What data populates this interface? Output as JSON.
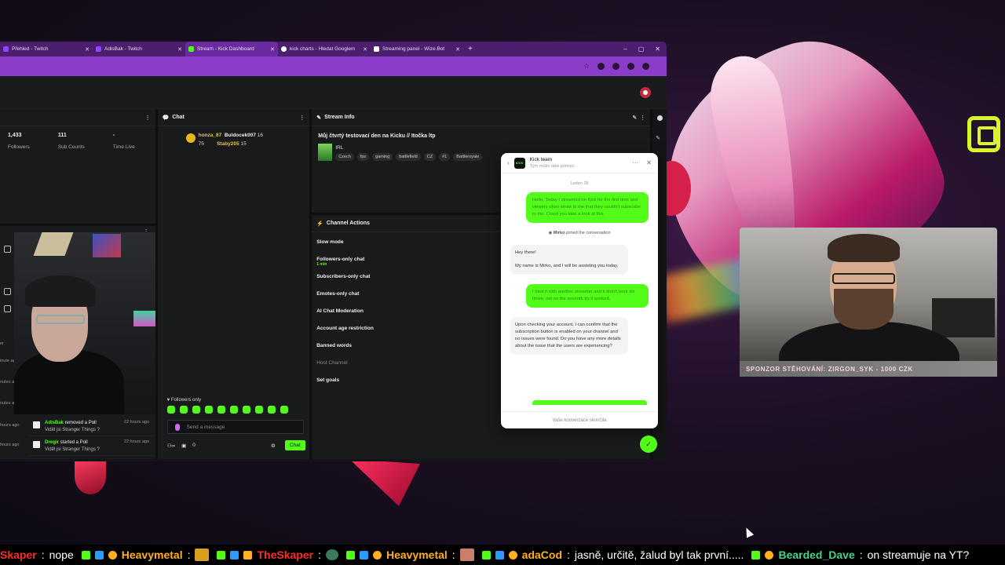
{
  "browser": {
    "tabs": [
      {
        "label": "Přehled - Twitch",
        "icon": "twitch-icon",
        "active": false
      },
      {
        "label": "AdisBak - Twitch",
        "icon": "twitch-icon",
        "active": false
      },
      {
        "label": "Stream - Kick Dashboard",
        "icon": "kick-icon",
        "active": true
      },
      {
        "label": "kick charts - Hledat Googlem",
        "icon": "google-icon",
        "active": false
      },
      {
        "label": "Streaming panel - Wize.Bot",
        "icon": "wizebot-icon",
        "active": false
      }
    ],
    "new_tab": "+",
    "window_controls": [
      "–",
      "▢",
      "✕"
    ]
  },
  "stats": {
    "followers_value": "1,433",
    "followers_label": "Followers",
    "subs_value": "111",
    "subs_label": "Sub Counts",
    "time_value": "-",
    "time_label": "Time Live"
  },
  "chat": {
    "title": "Chat",
    "messages": [
      {
        "user": "honza_87",
        "num": "75"
      },
      {
        "user": "Buldocek007",
        "num": "16"
      },
      {
        "user": "Staby205",
        "num": "15"
      }
    ],
    "followers_only": "Followers only",
    "placeholder": "Send a message",
    "count": "0",
    "send_label": "Chat"
  },
  "feed": [
    {
      "user": "AdisBak",
      "action": "removed a Poll",
      "sub": "Viděl jsi Stranger Things ?",
      "ago": "22 hours ago"
    },
    {
      "user": "Drogir",
      "action": "started a Poll",
      "sub": "Viděl jsi Stranger Things ?",
      "ago": "22 hours ago"
    }
  ],
  "side_labels": [
    "er",
    "inute ag",
    "nutes a",
    "nutes a",
    "hours ago",
    "hours ago"
  ],
  "stream_info": {
    "title": "Stream Info",
    "stream_title": "Můj čtvrtý testovací den na Kicku // Itočka ltp",
    "category": "IRL",
    "tags": [
      "Czech",
      "fps",
      "gaming",
      "battlefield",
      "CZ",
      "#1",
      "Battleroyale"
    ]
  },
  "channel_actions": {
    "title": "Channel Actions",
    "items": [
      {
        "label": "Slow mode",
        "sub": ""
      },
      {
        "label": "Followers-only chat",
        "sub": "1 min"
      },
      {
        "label": "Subscribers-only chat",
        "sub": ""
      },
      {
        "label": "Emotes-only chat",
        "sub": ""
      },
      {
        "label": "AI Chat Moderation",
        "sub": ""
      },
      {
        "label": "Account age restriction",
        "sub": ""
      },
      {
        "label": "Banned words",
        "sub": ""
      },
      {
        "label": "Host Channel",
        "sub": "",
        "dim": true
      },
      {
        "label": "Set goals",
        "sub": ""
      }
    ]
  },
  "support": {
    "name": "Kick team",
    "subtitle": "Tým může také pomoci",
    "date": "Leden 28",
    "msg_out_1": "Hello, Today I streamed on Kick for the first time and viewers often wrote to me that they couldn't subscribe to me. Could you take a look at this",
    "joined_user": "Mirko",
    "joined_text": "joined the conversation",
    "msg_in_1a": "Hey there!",
    "msg_in_1b": "My name is Mirko, and I will be assisting you today.",
    "msg_out_2": "I tried it with another streamer and it didn't work six times, not on the seventh try it worked.",
    "msg_in_2": "Upon checking your account, I can confirm that the subscription button is enabled on your channel and no issues were found. Do you have any more details about the issue that the users are experiencing?",
    "footer": "Vaše konverzace skončila"
  },
  "overlay": {
    "banner": "SPONZOR STĚHOVÁNÍ: ZIRGON_SYK - 1000 CZK"
  },
  "ticker": [
    {
      "user": "Skaper",
      "sep": " : ",
      "msg": "nope",
      "color": "#ff2a2a"
    },
    {
      "user": "Heavymetal",
      "sep": " : ",
      "msg": "",
      "color": "#ffb020"
    },
    {
      "user": "TheSkaper",
      "sep": " : ",
      "msg": "",
      "color": "#ff2a2a"
    },
    {
      "user": "Heavymetal",
      "sep": " : ",
      "msg": "",
      "color": "#ffb020"
    },
    {
      "user": "adaCod",
      "sep": " : ",
      "msg": "jasně, určitě, žalud byl tak první.....",
      "color": "#ffb020"
    },
    {
      "user": "Bearded_Dave",
      "sep": " : ",
      "msg": "on streamuje na YT?",
      "color": "#4ad08a"
    }
  ],
  "colors": {
    "kick_green": "#53fc18",
    "browser_purple": "#8b3cc8",
    "tab_purple": "#4b1e6e"
  }
}
